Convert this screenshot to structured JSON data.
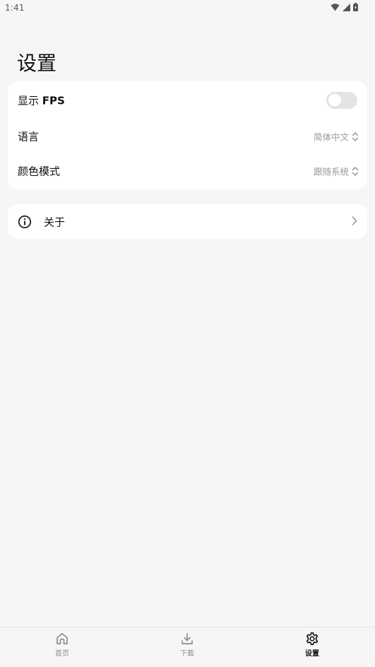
{
  "status_bar": {
    "time": "1:41",
    "icons": [
      "wifi-icon",
      "cell-signal-icon",
      "battery-icon"
    ]
  },
  "page": {
    "title": "设置"
  },
  "settings": {
    "show_fps": {
      "label_prefix": "显示 ",
      "label_bold": "FPS",
      "enabled": false
    },
    "language": {
      "label": "语言",
      "value": "简体中文"
    },
    "color_mode": {
      "label": "颜色模式",
      "value": "跟随系统"
    }
  },
  "about": {
    "label": "关于",
    "icon": "info-icon"
  },
  "bottom_nav": {
    "items": [
      {
        "label": "首页",
        "icon": "home-icon",
        "active": false
      },
      {
        "label": "下载",
        "icon": "download-icon",
        "active": false
      },
      {
        "label": "设置",
        "icon": "gear-icon",
        "active": true
      }
    ]
  },
  "colors": {
    "background": "#f6f6f6",
    "card": "#ffffff",
    "muted_text": "#9a9a9a",
    "toggle_off": "#e4e4e4"
  }
}
